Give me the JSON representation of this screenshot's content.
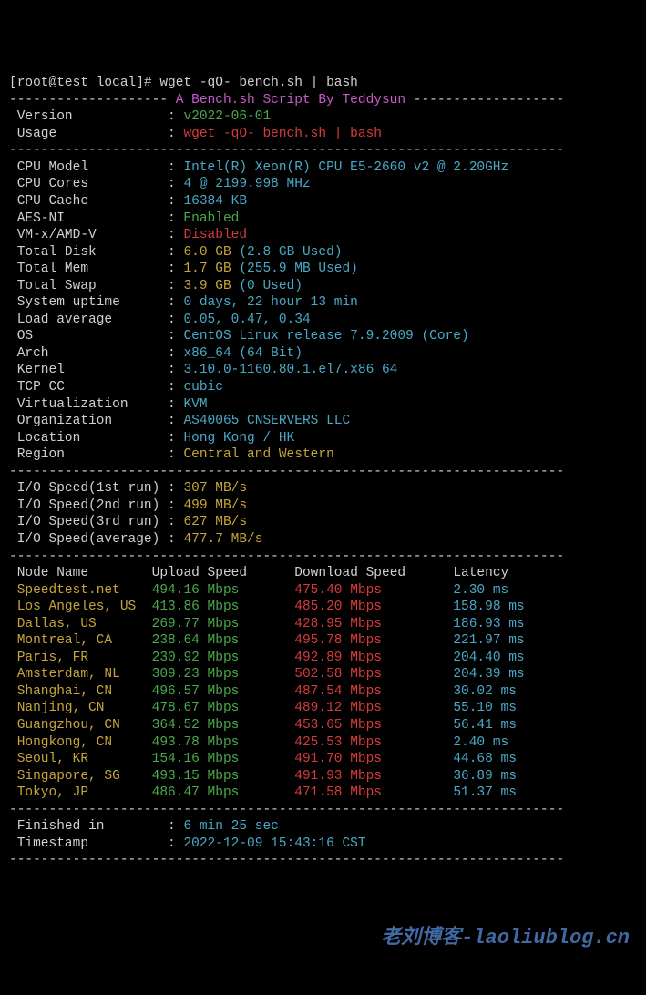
{
  "prompt": {
    "user_host": "[root@test local]#",
    "command": "wget -qO- bench.sh | bash"
  },
  "header": {
    "dashes_left": "-------------------- ",
    "title": "A Bench.sh Script By Teddysun",
    "dashes_right": " -------------------"
  },
  "meta": {
    "version_label": " Version            : ",
    "version_value": "v2022-06-01",
    "usage_label": " Usage              : ",
    "usage_value": "wget -qO- bench.sh | bash"
  },
  "hr": "----------------------------------------------------------------------",
  "sys": {
    "cpu_model_label": " CPU Model          : ",
    "cpu_model_value": "Intel(R) Xeon(R) CPU E5-2660 v2 @ 2.20GHz",
    "cpu_cores_label": " CPU Cores          : ",
    "cpu_cores_value": "4 @ 2199.998 MHz",
    "cpu_cache_label": " CPU Cache          : ",
    "cpu_cache_value": "16384 KB",
    "aesni_label": " AES-NI             : ",
    "aesni_value": "Enabled",
    "vmx_label": " VM-x/AMD-V         : ",
    "vmx_value": "Disabled",
    "disk_label": " Total Disk         : ",
    "disk_value": "6.0 GB",
    "disk_used": " (2.8 GB Used)",
    "mem_label": " Total Mem          : ",
    "mem_value": "1.7 GB",
    "mem_used": " (255.9 MB Used)",
    "swap_label": " Total Swap         : ",
    "swap_value": "3.9 GB",
    "swap_used": " (0 Used)",
    "uptime_label": " System uptime      : ",
    "uptime_value": "0 days, 22 hour 13 min",
    "load_label": " Load average       : ",
    "load_value": "0.05, 0.47, 0.34",
    "os_label": " OS                 : ",
    "os_value": "CentOS Linux release 7.9.2009 (Core)",
    "arch_label": " Arch               : ",
    "arch_value": "x86_64 (64 Bit)",
    "kernel_label": " Kernel             : ",
    "kernel_value": "3.10.0-1160.80.1.el7.x86_64",
    "tcp_label": " TCP CC             : ",
    "tcp_value": "cubic",
    "virt_label": " Virtualization     : ",
    "virt_value": "KVM",
    "org_label": " Organization       : ",
    "org_value": "AS40065 CNSERVERS LLC",
    "loc_label": " Location           : ",
    "loc_value": "Hong Kong / HK",
    "region_label": " Region             : ",
    "region_value": "Central and Western"
  },
  "io": {
    "r1_label": " I/O Speed(1st run) : ",
    "r1_value": "307 MB/s",
    "r2_label": " I/O Speed(2nd run) : ",
    "r2_value": "499 MB/s",
    "r3_label": " I/O Speed(3rd run) : ",
    "r3_value": "627 MB/s",
    "avg_label": " I/O Speed(average) : ",
    "avg_value": "477.7 MB/s"
  },
  "speed_header": {
    "node": " Node Name        ",
    "upload": "Upload Speed      ",
    "download": "Download Speed      ",
    "latency": "Latency     "
  },
  "speed": [
    {
      "node": " Speedtest.net    ",
      "up": "494.16 Mbps       ",
      "down": "475.40 Mbps         ",
      "lat": "2.30 ms     "
    },
    {
      "node": " Los Angeles, US  ",
      "up": "413.86 Mbps       ",
      "down": "485.20 Mbps         ",
      "lat": "158.98 ms   "
    },
    {
      "node": " Dallas, US       ",
      "up": "269.77 Mbps       ",
      "down": "428.95 Mbps         ",
      "lat": "186.93 ms   "
    },
    {
      "node": " Montreal, CA     ",
      "up": "238.64 Mbps       ",
      "down": "495.78 Mbps         ",
      "lat": "221.97 ms   "
    },
    {
      "node": " Paris, FR        ",
      "up": "230.92 Mbps       ",
      "down": "492.89 Mbps         ",
      "lat": "204.40 ms   "
    },
    {
      "node": " Amsterdam, NL    ",
      "up": "309.23 Mbps       ",
      "down": "502.58 Mbps         ",
      "lat": "204.39 ms   "
    },
    {
      "node": " Shanghai, CN     ",
      "up": "496.57 Mbps       ",
      "down": "487.54 Mbps         ",
      "lat": "30.02 ms    "
    },
    {
      "node": " Nanjing, CN      ",
      "up": "478.67 Mbps       ",
      "down": "489.12 Mbps         ",
      "lat": "55.10 ms    "
    },
    {
      "node": " Guangzhou, CN    ",
      "up": "364.52 Mbps       ",
      "down": "453.65 Mbps         ",
      "lat": "56.41 ms    "
    },
    {
      "node": " Hongkong, CN     ",
      "up": "493.78 Mbps       ",
      "down": "425.53 Mbps         ",
      "lat": "2.40 ms     "
    },
    {
      "node": " Seoul, KR        ",
      "up": "154.16 Mbps       ",
      "down": "491.70 Mbps         ",
      "lat": "44.68 ms    "
    },
    {
      "node": " Singapore, SG    ",
      "up": "493.15 Mbps       ",
      "down": "491.93 Mbps         ",
      "lat": "36.89 ms    "
    },
    {
      "node": " Tokyo, JP        ",
      "up": "486.47 Mbps       ",
      "down": "471.58 Mbps         ",
      "lat": "51.37 ms    "
    }
  ],
  "footer": {
    "finished_label": " Finished in        : ",
    "finished_value": "6 min 25 sec",
    "ts_label": " Timestamp          : ",
    "ts_value": "2022-12-09 15:43:16 CST"
  },
  "watermark": "老刘博客-laoliublog.cn"
}
